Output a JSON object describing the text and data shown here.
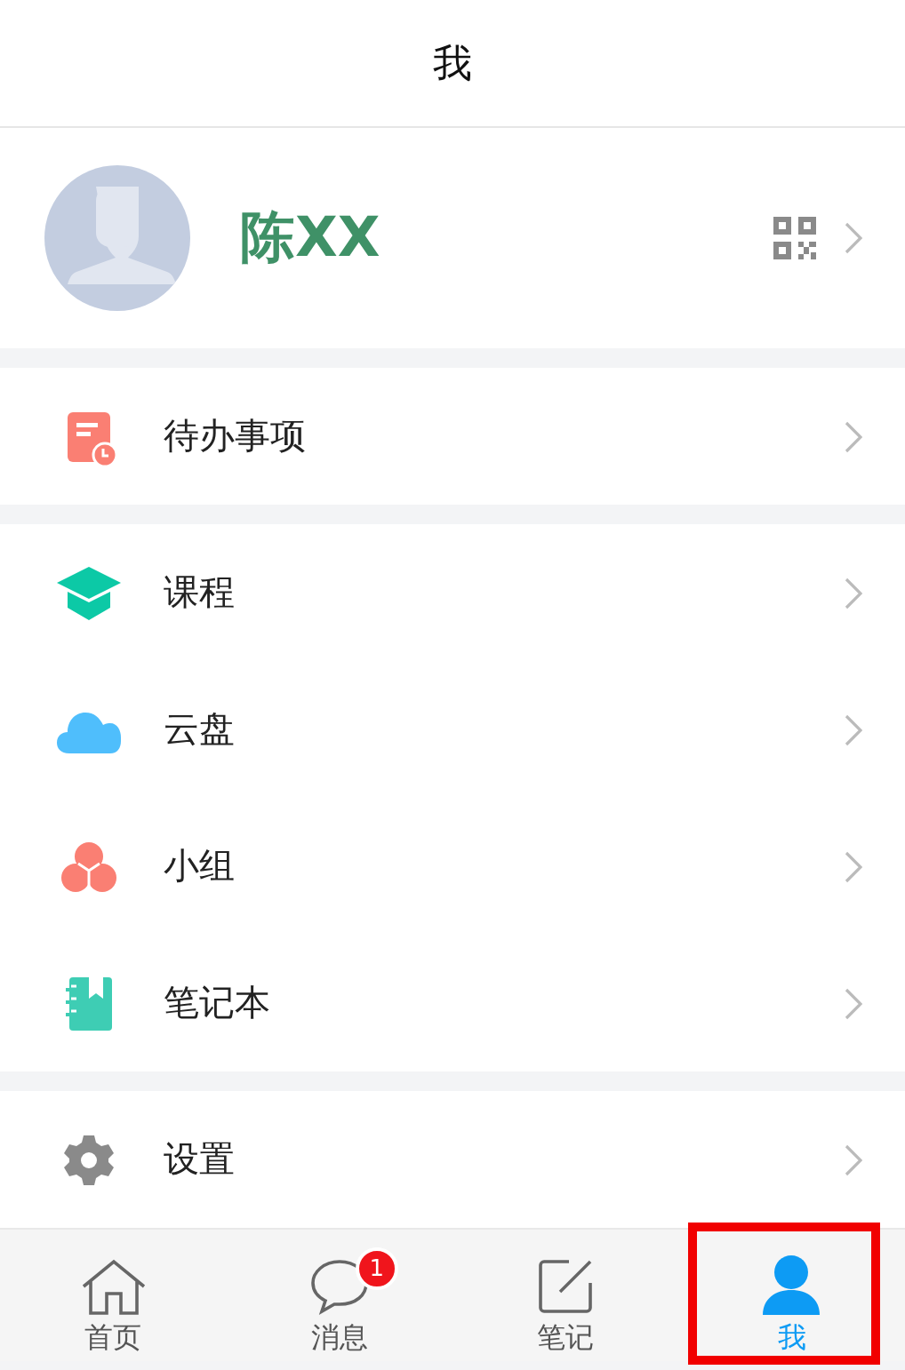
{
  "header": {
    "title": "我"
  },
  "profile": {
    "name": "陈XX"
  },
  "sections": [
    {
      "items": [
        {
          "label": "待办事项"
        }
      ]
    },
    {
      "items": [
        {
          "label": "课程"
        },
        {
          "label": "云盘"
        },
        {
          "label": "小组"
        },
        {
          "label": "笔记本"
        }
      ]
    },
    {
      "items": [
        {
          "label": "设置"
        }
      ]
    }
  ],
  "tabs": [
    {
      "label": "首页",
      "selected": false,
      "highlighted": false
    },
    {
      "label": "消息",
      "selected": false,
      "highlighted": false,
      "badge": "1"
    },
    {
      "label": "笔记",
      "selected": false,
      "highlighted": false
    },
    {
      "label": "我",
      "selected": true,
      "highlighted": true
    }
  ]
}
